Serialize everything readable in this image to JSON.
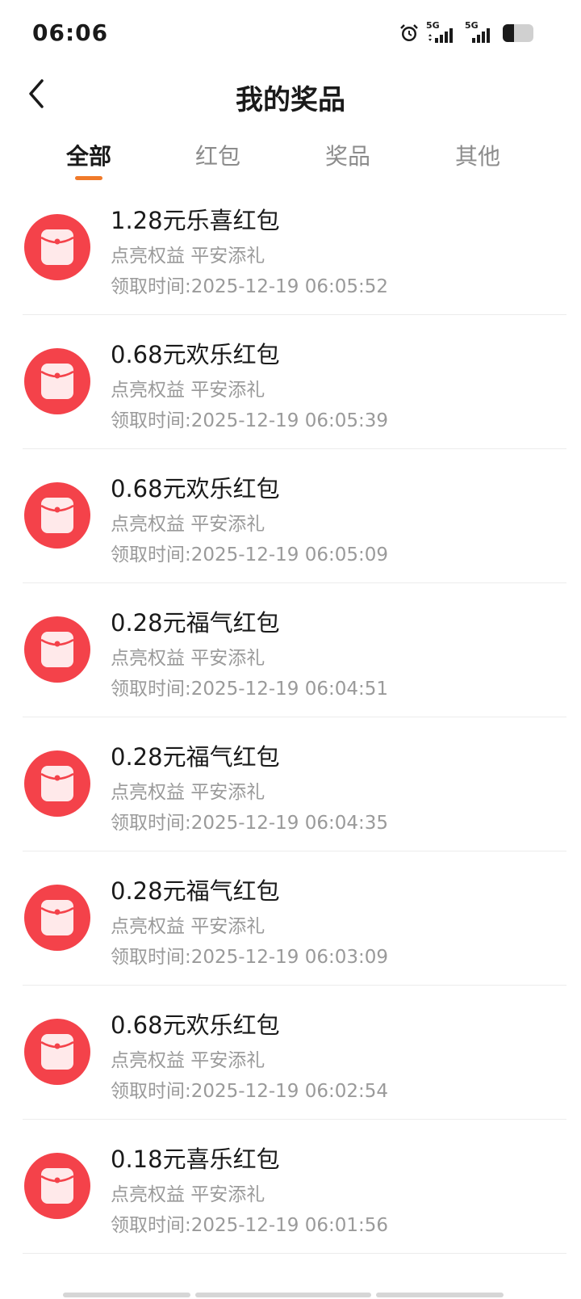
{
  "status_bar": {
    "time": "06:06",
    "network_1": "5G",
    "network_2": "5G"
  },
  "header": {
    "title": "我的奖品"
  },
  "tabs": [
    {
      "label": "全部",
      "active": true
    },
    {
      "label": "红包",
      "active": false
    },
    {
      "label": "奖品",
      "active": false
    },
    {
      "label": "其他",
      "active": false
    }
  ],
  "prizes": [
    {
      "name": "1.28元乐喜红包",
      "source": "点亮权益 平安添礼",
      "time": "领取时间:2025-12-19 06:05:52"
    },
    {
      "name": "0.68元欢乐红包",
      "source": "点亮权益 平安添礼",
      "time": "领取时间:2025-12-19 06:05:39"
    },
    {
      "name": "0.68元欢乐红包",
      "source": "点亮权益 平安添礼",
      "time": "领取时间:2025-12-19 06:05:09"
    },
    {
      "name": "0.28元福气红包",
      "source": "点亮权益 平安添礼",
      "time": "领取时间:2025-12-19 06:04:51"
    },
    {
      "name": "0.28元福气红包",
      "source": "点亮权益 平安添礼",
      "time": "领取时间:2025-12-19 06:04:35"
    },
    {
      "name": "0.28元福气红包",
      "source": "点亮权益 平安添礼",
      "time": "领取时间:2025-12-19 06:03:09"
    },
    {
      "name": "0.68元欢乐红包",
      "source": "点亮权益 平安添礼",
      "time": "领取时间:2025-12-19 06:02:54"
    },
    {
      "name": "0.18元喜乐红包",
      "source": "点亮权益 平安添礼",
      "time": "领取时间:2025-12-19 06:01:56"
    }
  ],
  "colors": {
    "accent": "#f07a2a",
    "red_packet": "#f4424a",
    "secondary_text": "#9a9a9a"
  },
  "icons": {
    "back": "chevron-left-icon",
    "prize": "red-envelope-icon"
  }
}
